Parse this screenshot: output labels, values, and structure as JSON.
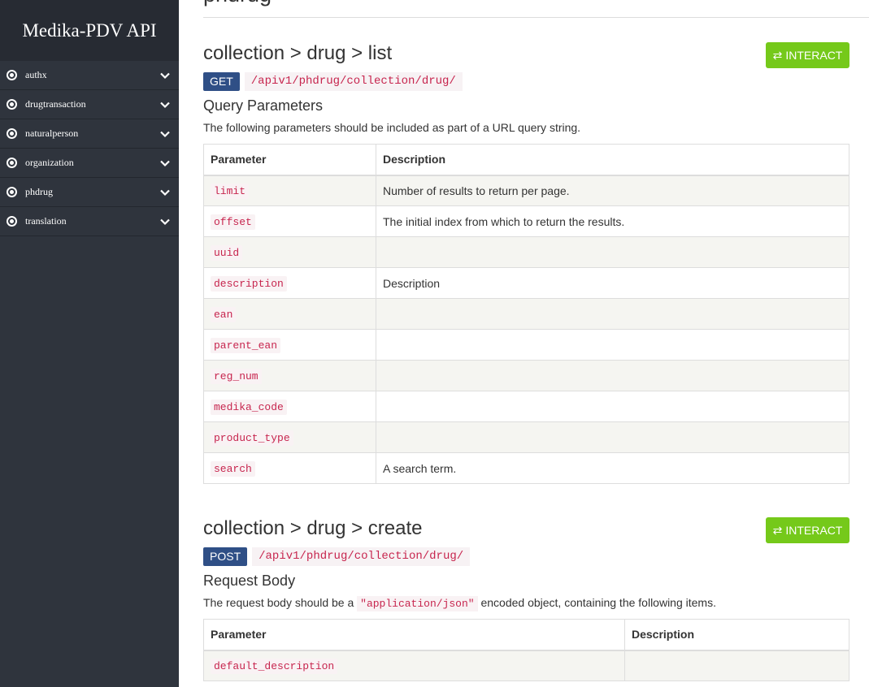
{
  "sidebar": {
    "brand": "Medika-PDV API",
    "items": [
      {
        "label": "authx"
      },
      {
        "label": "drugtransaction"
      },
      {
        "label": "naturalperson"
      },
      {
        "label": "organization"
      },
      {
        "label": "phdrug"
      },
      {
        "label": "translation"
      }
    ]
  },
  "main": {
    "section_title": "phdrug",
    "endpoints": [
      {
        "title": "collection > drug > list",
        "interact_label": "INTERACT",
        "method": "GET",
        "path": "/apiv1/phdrug/collection/drug/",
        "params_heading": "Query Parameters",
        "params_desc": "The following parameters should be included as part of a URL query string.",
        "columns": [
          "Parameter",
          "Description"
        ],
        "rows": [
          {
            "param": "limit",
            "desc": "Number of results to return per page."
          },
          {
            "param": "offset",
            "desc": "The initial index from which to return the results."
          },
          {
            "param": "uuid",
            "desc": ""
          },
          {
            "param": "description",
            "desc": "Description"
          },
          {
            "param": "ean",
            "desc": ""
          },
          {
            "param": "parent_ean",
            "desc": ""
          },
          {
            "param": "reg_num",
            "desc": ""
          },
          {
            "param": "medika_code",
            "desc": ""
          },
          {
            "param": "product_type",
            "desc": ""
          },
          {
            "param": "search",
            "desc": "A search term."
          }
        ]
      },
      {
        "title": "collection > drug > create",
        "interact_label": "INTERACT",
        "method": "POST",
        "path": "/apiv1/phdrug/collection/drug/",
        "params_heading": "Request Body",
        "params_desc_before": "The request body should be a",
        "params_desc_code": "\"application/json\"",
        "params_desc_after": "encoded object, containing the following items.",
        "columns": [
          "Parameter",
          "Description"
        ],
        "rows": [
          {
            "param": "default_description",
            "desc": ""
          }
        ]
      }
    ]
  },
  "colors": {
    "sidebar_bg": "#2f343d",
    "brand_bg": "#272b33",
    "interact_green": "#75c91a",
    "method_blue": "#2f4f86",
    "code_red": "#c7254e"
  }
}
